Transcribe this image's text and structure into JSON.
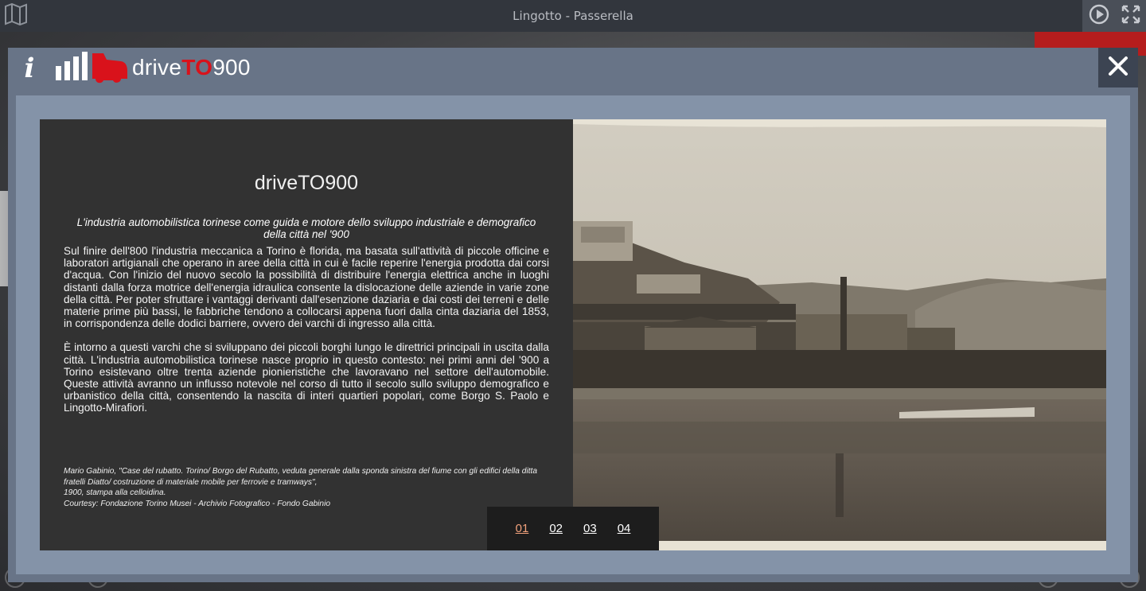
{
  "window": {
    "title": "Lingotto - Passerella"
  },
  "modal": {
    "logo": {
      "prefix": "drive",
      "highlight": "TO",
      "suffix": "900"
    },
    "info_label": "i"
  },
  "article": {
    "title": "driveTO900",
    "subtitle": "L'industria automobilistica torinese come guida e motore dello sviluppo industriale e demografico della città nel '900",
    "paragraph1": "Sul finire dell'800 l'industria meccanica a Torino è florida, ma basata sull'attività di piccole officine e laboratori artigianali che operano in aree della città in cui è facile reperire l'energia prodotta dai corsi d'acqua. Con l'inizio del nuovo secolo la possibilità di distribuire l'energia elettrica anche in luoghi distanti dalla forza motrice dell'energia idraulica consente la dislocazione delle aziende in varie zone della città. Per poter sfruttare i vantaggi derivanti dall'esenzione daziaria e dai costi dei terreni e delle materie prime più bassi, le fabbriche tendono a collocarsi appena fuori dalla cinta daziaria del 1853, in corrispondenza delle dodici barriere, ovvero dei varchi di ingresso alla città.",
    "paragraph2": "È intorno a questi varchi che si sviluppano dei piccoli borghi lungo le direttrici principali in uscita dalla città. L'industria automobilistica torinese nasce proprio in questo contesto: nei primi anni del '900 a Torino esistevano oltre trenta aziende pionieristiche che lavoravano nel settore dell'automobile. Queste attività avranno un influsso notevole nel corso di tutto il secolo sullo sviluppo demografico e urbanistico della città, consentendo la nascita di interi quartieri popolari, come Borgo S. Paolo e Lingotto-Mirafiori.",
    "credit_line1": "Mario Gabinio, \"Case del rubatto. Torino/ Borgo del Rubatto, veduta generale dalla sponda sinistra del fiume con gli edifici della ditta fratelli Diatto/ costruzione di materiale mobile per ferrovie e tramways\",",
    "credit_line2": "1900, stampa alla celloidina.",
    "credit_line3": "Courtesy: Fondazione Torino Musei - Archivio Fotografico - Fondo Gabinio"
  },
  "pager": {
    "pages": [
      "01",
      "02",
      "03",
      "04"
    ],
    "active": "01"
  },
  "colors": {
    "accent": "#d9121b",
    "active_page": "#f2a27c",
    "modal_bg": "#687487"
  },
  "icons": [
    "map-icon",
    "play-icon",
    "fullscreen-icon",
    "info-icon",
    "close-icon"
  ]
}
